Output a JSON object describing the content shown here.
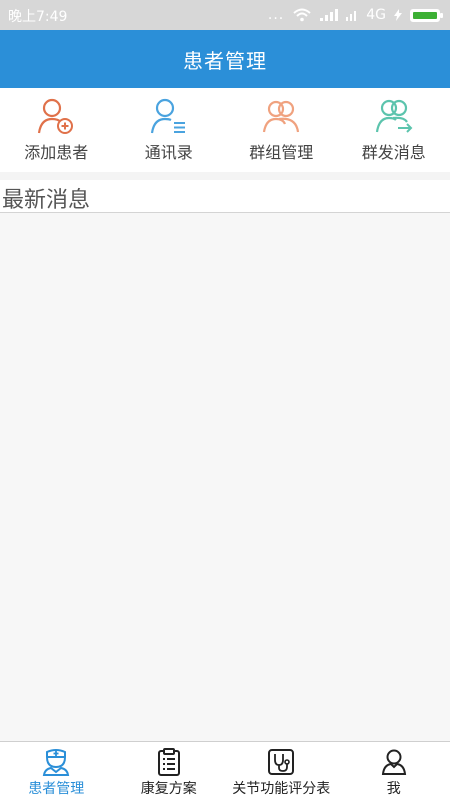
{
  "status_bar": {
    "time": "晚上7:49",
    "dots": "...",
    "network": "4G"
  },
  "header": {
    "title": "患者管理"
  },
  "actions": [
    {
      "label": "添加患者",
      "icon": "add-patient-icon",
      "color": "#e0714a"
    },
    {
      "label": "通讯录",
      "icon": "contacts-icon",
      "color": "#4aa3df"
    },
    {
      "label": "群组管理",
      "icon": "group-manage-icon",
      "color": "#f0a27f"
    },
    {
      "label": "群发消息",
      "icon": "broadcast-icon",
      "color": "#5cc4ad"
    }
  ],
  "section": {
    "title": "最新消息"
  },
  "bottom_nav": [
    {
      "label": "患者管理",
      "icon": "nurse-icon",
      "active": true
    },
    {
      "label": "康复方案",
      "icon": "clipboard-icon",
      "active": false
    },
    {
      "label": "关节功能评分表",
      "icon": "stethoscope-icon",
      "active": false
    },
    {
      "label": "我",
      "icon": "user-icon",
      "active": false
    }
  ],
  "colors": {
    "accent": "#2b8fd8",
    "status_bar": "#d7d7d7",
    "battery": "#3cb034"
  }
}
